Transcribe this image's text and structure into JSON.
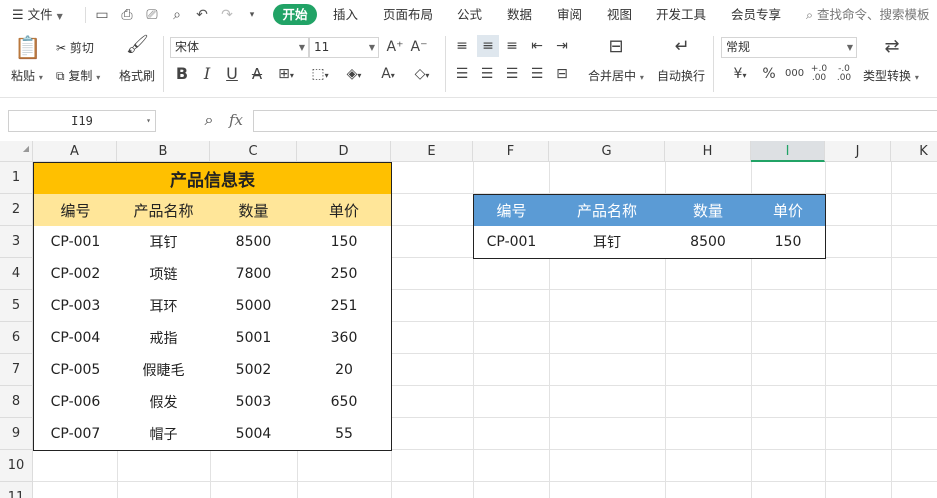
{
  "menubar": {
    "file_label": "文件",
    "tabs": [
      "开始",
      "插入",
      "页面布局",
      "公式",
      "数据",
      "审阅",
      "视图",
      "开发工具",
      "会员专享"
    ],
    "search_placeholder": "查找命令、搜索模板"
  },
  "ribbon": {
    "paste": "粘贴",
    "cut": "剪切",
    "copy": "复制",
    "format_painter": "格式刷",
    "font_name": "宋体",
    "font_size": "11",
    "merge_center": "合并居中",
    "wrap_text": "自动换行",
    "number_format": "常规",
    "type_convert": "类型转换"
  },
  "formula_bar": {
    "cell_ref": "I19",
    "fx_label": "fx",
    "formula": ""
  },
  "columns": [
    "A",
    "B",
    "C",
    "D",
    "E",
    "F",
    "G",
    "H",
    "I",
    "J",
    "K"
  ],
  "selected_column": "I",
  "rows": [
    "1",
    "2",
    "3",
    "4",
    "5",
    "6",
    "7",
    "8",
    "9",
    "10",
    "11"
  ],
  "table1": {
    "title": "产品信息表",
    "headers": [
      "编号",
      "产品名称",
      "数量",
      "单价"
    ],
    "rows": [
      [
        "CP-001",
        "耳钉",
        "8500",
        "150"
      ],
      [
        "CP-002",
        "项链",
        "7800",
        "250"
      ],
      [
        "CP-003",
        "耳环",
        "5000",
        "251"
      ],
      [
        "CP-004",
        "戒指",
        "5001",
        "360"
      ],
      [
        "CP-005",
        "假睫毛",
        "5002",
        "20"
      ],
      [
        "CP-006",
        "假发",
        "5003",
        "650"
      ],
      [
        "CP-007",
        "帽子",
        "5004",
        "55"
      ]
    ]
  },
  "table2": {
    "headers": [
      "编号",
      "产品名称",
      "数量",
      "单价"
    ],
    "rows": [
      [
        "CP-001",
        "耳钉",
        "8500",
        "150"
      ]
    ]
  },
  "colors": {
    "accent_green": "#21a366",
    "title_fill": "#ffc000",
    "header_fill_yellow": "#ffe699",
    "header_fill_blue": "#5b9bd5"
  }
}
